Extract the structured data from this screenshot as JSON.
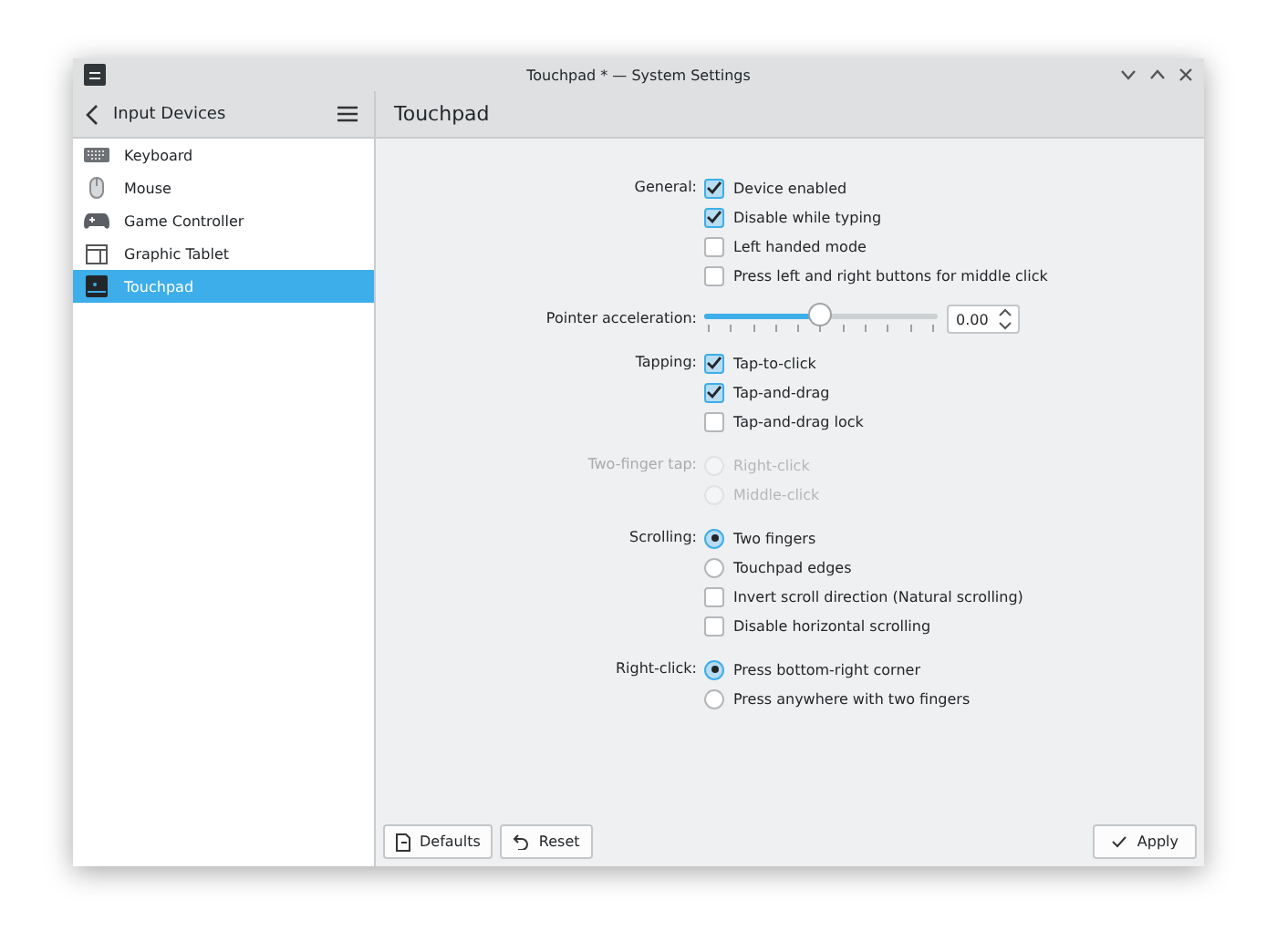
{
  "window": {
    "title": "Touchpad * — System Settings"
  },
  "sidebar": {
    "title": "Input Devices",
    "items": [
      {
        "label": "Keyboard",
        "kind": "keyboard",
        "selected": false
      },
      {
        "label": "Mouse",
        "kind": "mouse",
        "selected": false
      },
      {
        "label": "Game Controller",
        "kind": "gamepad",
        "selected": false
      },
      {
        "label": "Graphic Tablet",
        "kind": "tablet",
        "selected": false
      },
      {
        "label": "Touchpad",
        "kind": "touchpad",
        "selected": true
      }
    ]
  },
  "page": {
    "title": "Touchpad"
  },
  "sections": [
    {
      "label": "General:",
      "kind": "options",
      "disabled": false,
      "options": [
        {
          "kind": "checkbox",
          "label": "Device enabled",
          "checked": true
        },
        {
          "kind": "checkbox",
          "label": "Disable while typing",
          "checked": true
        },
        {
          "kind": "checkbox",
          "label": "Left handed mode",
          "checked": false
        },
        {
          "kind": "checkbox",
          "label": "Press left and right buttons for middle click",
          "checked": false
        }
      ]
    },
    {
      "label": "Pointer acceleration:",
      "kind": "slider",
      "disabled": false,
      "level": 0.5,
      "value": "0.00"
    },
    {
      "label": "Tapping:",
      "kind": "options",
      "disabled": false,
      "options": [
        {
          "kind": "checkbox",
          "label": "Tap-to-click",
          "checked": true
        },
        {
          "kind": "checkbox",
          "label": "Tap-and-drag",
          "checked": true
        },
        {
          "kind": "checkbox",
          "label": "Tap-and-drag lock",
          "checked": false
        }
      ]
    },
    {
      "label": "Two-finger tap:",
      "kind": "options",
      "disabled": true,
      "options": [
        {
          "kind": "radio",
          "label": "Right-click",
          "checked": false
        },
        {
          "kind": "radio",
          "label": "Middle-click",
          "checked": false
        }
      ]
    },
    {
      "label": "Scrolling:",
      "kind": "options",
      "disabled": false,
      "options": [
        {
          "kind": "radio",
          "label": "Two fingers",
          "checked": true
        },
        {
          "kind": "radio",
          "label": "Touchpad edges",
          "checked": false
        },
        {
          "kind": "checkbox",
          "label": "Invert scroll direction (Natural scrolling)",
          "checked": false
        },
        {
          "kind": "checkbox",
          "label": "Disable horizontal scrolling",
          "checked": false
        }
      ]
    },
    {
      "label": "Right-click:",
      "kind": "options",
      "disabled": false,
      "options": [
        {
          "kind": "radio",
          "label": "Press bottom-right corner",
          "checked": true
        },
        {
          "kind": "radio",
          "label": "Press anywhere with two fingers",
          "checked": false
        }
      ]
    }
  ],
  "footer": {
    "left_buttons": [
      {
        "label": "Defaults",
        "kind": "defaults"
      },
      {
        "label": "Reset",
        "kind": "reset"
      }
    ],
    "right_buttons": [
      {
        "label": "Apply",
        "kind": "apply"
      }
    ]
  }
}
